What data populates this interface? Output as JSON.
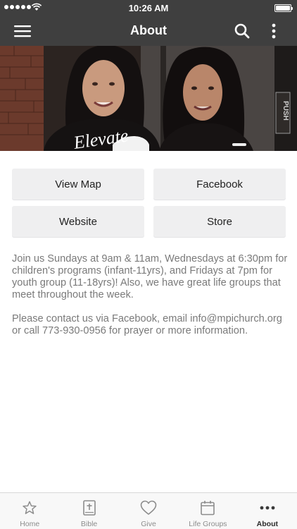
{
  "status_bar": {
    "time": "10:26 AM"
  },
  "nav": {
    "title": "About"
  },
  "hero": {
    "shirt_text": "Elevate",
    "door_sign": "PUSH"
  },
  "buttons": {
    "view_map": "View Map",
    "facebook": "Facebook",
    "website": "Website",
    "store": "Store"
  },
  "content": {
    "paragraph1": "Join us Sundays at 9am & 11am, Wednesdays at 6:30pm for children's programs (infant-11yrs), and Fridays at 7pm for youth group (11-18yrs)! Also, we have great life groups that meet throughout the week.",
    "paragraph2": "Please contact us via Facebook, email info@mpichurch.org or call 773-930-0956 for prayer or more information."
  },
  "tabs": [
    {
      "label": "Home",
      "icon": "star-icon"
    },
    {
      "label": "Bible",
      "icon": "bible-icon"
    },
    {
      "label": "Give",
      "icon": "heart-icon"
    },
    {
      "label": "Life Groups",
      "icon": "calendar-icon"
    },
    {
      "label": "About",
      "icon": "more-dots-icon",
      "active": true
    }
  ],
  "colors": {
    "bar": "#3f3f3f",
    "button_bg": "#efeff0",
    "body_text": "#7a7a7a"
  }
}
